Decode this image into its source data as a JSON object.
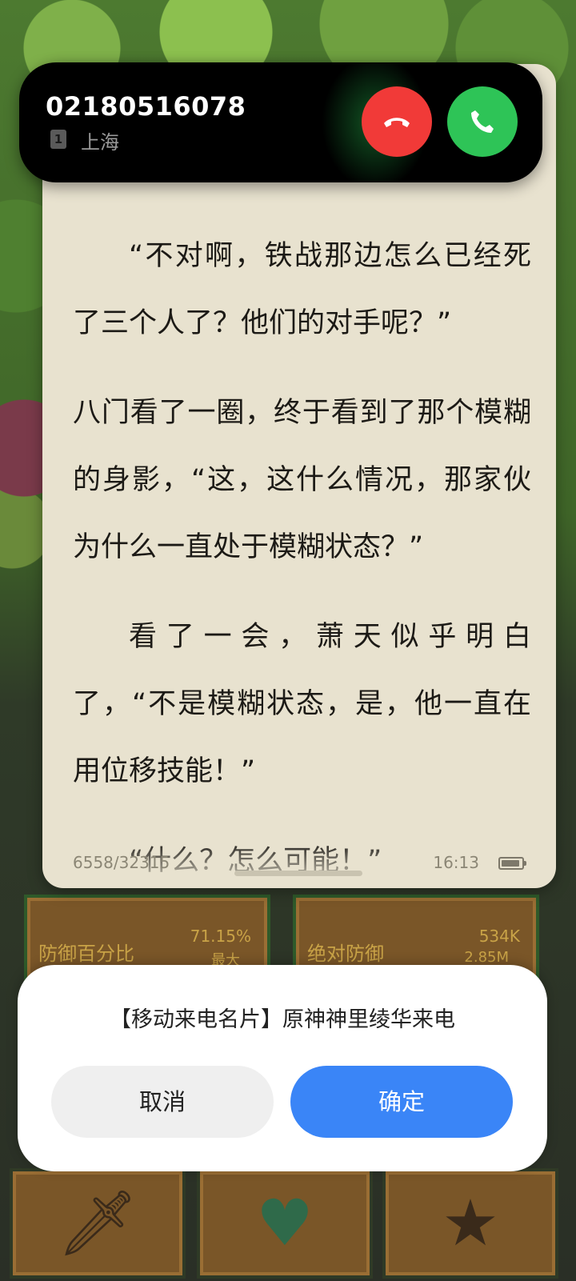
{
  "call": {
    "number": "02180516078",
    "sim_slot": "1",
    "location": "上海",
    "decline_icon": "phone-hangup-icon",
    "accept_icon": "phone-icon"
  },
  "reader": {
    "paragraphs": [
      "“不对啊，铁战那边怎么已经死了三个人了？他们的对手呢？”",
      "八门看了一圈，终于看到了那个模糊的身影，“这，这什么情况，那家伙为什么一直处于模糊状态？”",
      "看了一会，萧天似乎明白了，“不是模糊状态，是，他一直在用位移技能！”",
      "“什么？怎么可能！”"
    ],
    "progress": "6558/32315",
    "time": "16:13"
  },
  "game": {
    "defense_percent_label": "防御百分比",
    "defense_percent_value": "71.15%",
    "defense_percent_sub": "最大",
    "absolute_defense_label": "绝对防御",
    "absolute_defense_value": "534K",
    "absolute_defense_sub": "2.85M",
    "bottom_icons": [
      "sword-icon",
      "heart-icon",
      "star-icon"
    ]
  },
  "dialog": {
    "message": "【移动来电名片】原神神里绫华来电",
    "cancel_label": "取消",
    "confirm_label": "确定"
  },
  "colors": {
    "reader_bg": "#e8e2cf",
    "decline": "#f13a38",
    "accept": "#2ec457",
    "confirm": "#3a85f7"
  }
}
